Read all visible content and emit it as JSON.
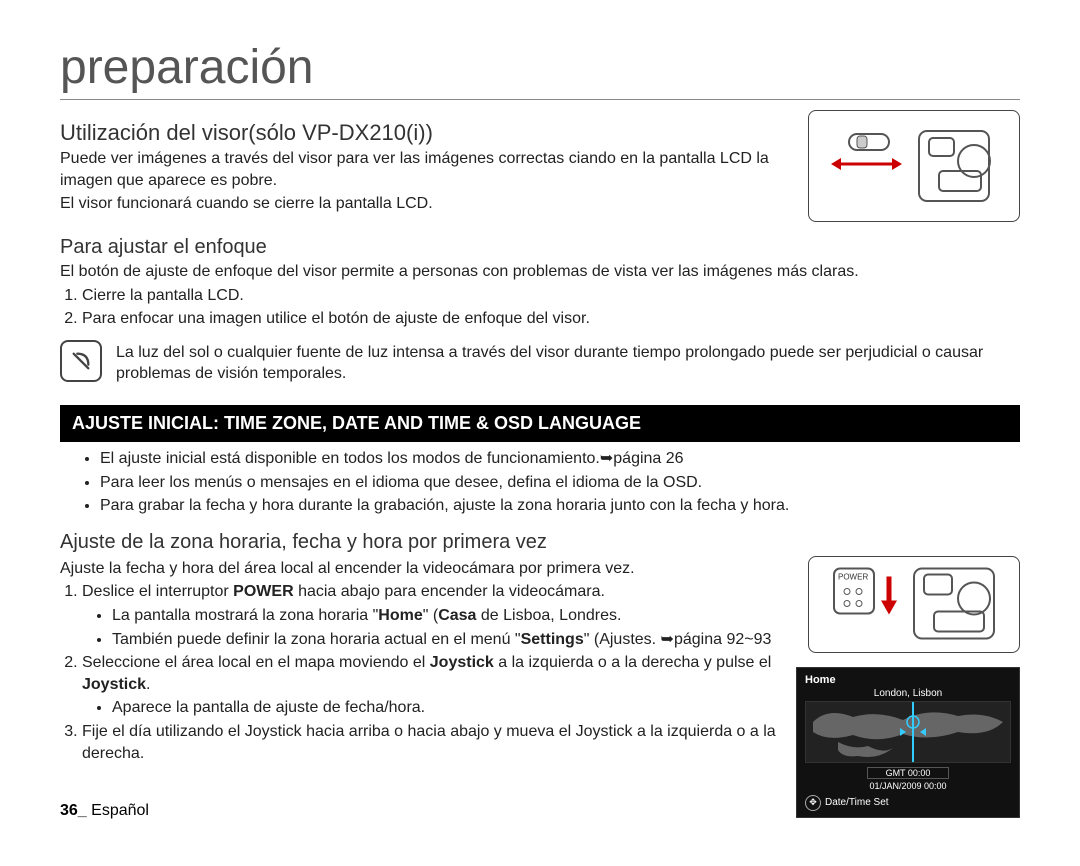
{
  "title": "preparación",
  "section1": {
    "heading": "Utilización del visor(sólo VP-DX210(i))",
    "p1": "Puede ver imágenes a través del visor para ver las imágenes correctas ciando en la pantalla LCD la imagen que aparece es pobre.",
    "p2": "El visor funcionará cuando se cierre la pantalla LCD."
  },
  "section2": {
    "heading": "Para ajustar el enfoque",
    "p1": "El botón de ajuste de enfoque del visor permite a personas con problemas de vista ver las imágenes más claras.",
    "li1_prefix": "1.",
    "li1": "Cierre la pantalla LCD.",
    "li2_prefix": "2.",
    "li2": "Para enfocar una imagen utilice el botón de ajuste de enfoque del visor.",
    "note": "La luz del sol o cualquier fuente de luz intensa a través del visor durante tiempo prolongado puede ser perjudicial o causar problemas de visión temporales."
  },
  "black_bar": "AJUSTE INICIAL: TIME ZONE, DATE AND TIME & OSD LANGUAGE",
  "bullets": {
    "b1": "El ajuste inicial está disponible en todos los modos de funcionamiento.➥página 26",
    "b2": "Para leer los menús o mensajes en el idioma que desee, defina el idioma de la OSD.",
    "b3": "Para grabar la fecha y hora durante la grabación, ajuste la zona horaria junto con la fecha y hora."
  },
  "section3": {
    "heading": "Ajuste de la zona horaria, fecha y hora por primera vez",
    "p1": "Ajuste la fecha y hora del área local al encender la videocámara por primera vez.",
    "li1a": "Deslice el interruptor ",
    "li1b_bold": "POWER",
    "li1c": " hacia abajo para encender la videocámara.",
    "li1_sub_a": "La pantalla mostrará la zona horaria \"",
    "li1_sub_b_bold": "Home",
    "li1_sub_c": "\" (",
    "li1_sub_d_bold": "Casa",
    "li1_sub_e": " de Lisboa, Londres.",
    "li1_sub2_a": "También puede definir la zona horaria actual en el menú \"",
    "li1_sub2_b_bold": "Settings",
    "li1_sub2_c": "\" (Ajustes. ➥página 92~93",
    "li2a": "Seleccione el área local en el mapa moviendo el ",
    "li2b_bold": "Joystick",
    "li2c": " a la izquierda o a la derecha y pulse el ",
    "li2d_bold": "Joystick",
    "li2e": ".",
    "li2_sub": "Aparece la pantalla de ajuste de fecha/hora.",
    "li3": "Fije el día utilizando el Joystick hacia arriba o hacia abajo y mueva el Joystick a la izquierda o a la derecha."
  },
  "power_label": "POWER",
  "screen": {
    "home": "Home",
    "loc": "London, Lisbon",
    "gmt": "GMT 00:00",
    "date": "01/JAN/2009 00:00",
    "dts": "Date/Time Set"
  },
  "footer_page": "36_",
  "footer_lang": " Español"
}
